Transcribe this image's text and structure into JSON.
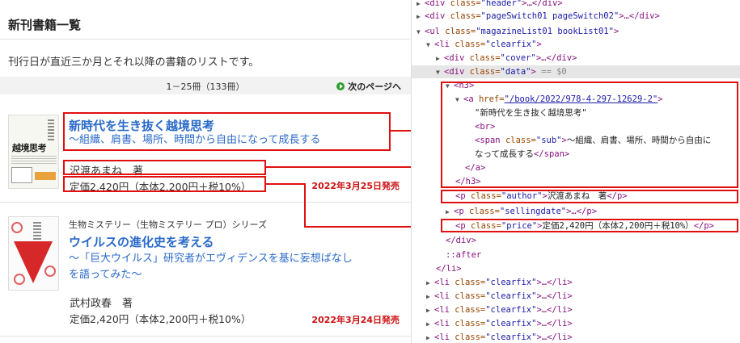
{
  "page": {
    "title": "新刊書籍一覧",
    "intro": "刊行日が直近三か月とそれ以降の書籍のリストです。",
    "pager_count": "1－25冊（133冊）",
    "pager_next": "次のページへ"
  },
  "books": [
    {
      "title": "新時代を生き抜く越境思考",
      "subtitle": "～組織、肩書、場所、時間から自由になって成長する",
      "author": "沢渡あまね　著",
      "price": "定価2,420円（本体2,200円＋税10%）",
      "date": "2022年3月25日発売",
      "cover_text": "越境思考"
    },
    {
      "series": "生物ミステリー（生物ミステリー プロ）シリーズ",
      "title": "ウイルスの進化史を考える",
      "subtitle_line1": "～「巨大ウイルス」研究者がエヴィデンスを基に妄想ばなし",
      "subtitle_line2": "を語ってみた～",
      "author": "武村政春　著",
      "price": "定価2,420円（本体2,200円＋税10%）",
      "date": "2022年3月24日発売"
    }
  ],
  "devtools": {
    "l0": {
      "open": "<div ",
      "attr": "class=",
      "val": "\"header\"",
      "close": ">…</div>"
    },
    "l1": {
      "open": "<div ",
      "attr": "class=",
      "val": "\"pageSwitch01 pageSwitch02\"",
      "close": ">…</div>"
    },
    "l2": {
      "open": "<ul ",
      "attr": "class=",
      "val": "\"magazineList01 bookList01\"",
      "close": ">"
    },
    "l3": {
      "open": "<li ",
      "attr": "class=",
      "val": "\"clearfix\"",
      "close": ">"
    },
    "l4": {
      "open": "<div ",
      "attr": "class=",
      "val": "\"cover\"",
      "close": ">…</div>"
    },
    "l5": {
      "open": "<div ",
      "attr": "class=",
      "val": "\"data\"",
      "close": ">",
      "extra": " == $0"
    },
    "l6": {
      "open": "<h3>"
    },
    "l7": {
      "open": "<a ",
      "attr": "href=",
      "val": "\"/book/2022/978-4-297-12629-2\"",
      "close": ">"
    },
    "l8": {
      "text": "\"新時代を生き抜く越境思考\""
    },
    "l9": {
      "open": "<br>"
    },
    "l10": {
      "open": "<span ",
      "attr": "class=",
      "val": "\"sub\"",
      "close": ">",
      "text": "～組織、肩書、場所、時間から自由に"
    },
    "l11": {
      "text": "なって成長する",
      "close": "</span>"
    },
    "l12": {
      "open": "</a>"
    },
    "l13": {
      "open": "</h3>"
    },
    "l14": {
      "open": "<p ",
      "attr": "class=",
      "val": "\"author\"",
      "close": ">",
      "text": "沢渡あまね　著",
      "end": "</p>"
    },
    "l15": {
      "open": "<p ",
      "attr": "class=",
      "val": "\"sellingdate\"",
      "close": ">…</p>"
    },
    "l16": {
      "open": "<p ",
      "attr": "class=",
      "val": "\"price\"",
      "close": ">",
      "text": "定価2,420円（本体2,200円＋税10%）",
      "end": "</p>"
    },
    "l17": {
      "open": "</div>"
    },
    "l18": {
      "text": "::after"
    },
    "l19": {
      "open": "</li>"
    },
    "li_item": {
      "open": "<li ",
      "attr": "class=",
      "val": "\"clearfix\"",
      "close": ">…</li>"
    }
  }
}
